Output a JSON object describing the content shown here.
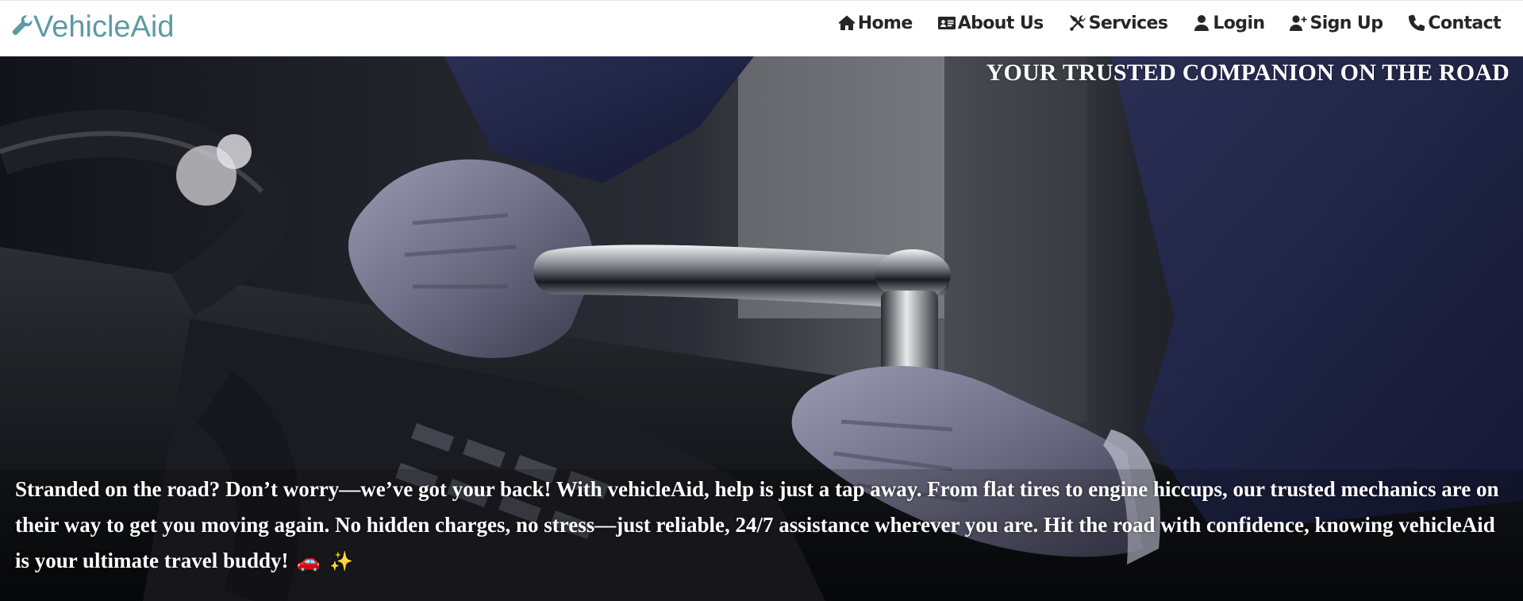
{
  "brand": {
    "name": "VehicleAid",
    "icon": "wrench-icon",
    "color": "#5e9aa3"
  },
  "nav": {
    "items": [
      {
        "label": "Home",
        "icon": "home-icon"
      },
      {
        "label": "About Us",
        "icon": "id-card-icon"
      },
      {
        "label": "Services",
        "icon": "tools-icon"
      },
      {
        "label": "Login",
        "icon": "user-icon"
      },
      {
        "label": "Sign Up",
        "icon": "user-plus-icon"
      },
      {
        "label": "Contact",
        "icon": "phone-icon"
      }
    ]
  },
  "hero": {
    "tagline": "YOUR TRUSTED COMPANION ON THE ROAD",
    "description": "Stranded on the road? Don’t worry—we’ve got your back! With vehicleAid, help is just a tap away. From flat tires to engine hiccups, our trusted mechanics are on their way to get you moving again. No hidden charges, no stress—just reliable, 24/7 assistance wherever you are. Hit the road with confidence, knowing vehicleAid is your ultimate travel buddy!",
    "emoji_car": "🚗",
    "emoji_sparkle": "✨",
    "background_image": "mechanic-wrench-engine-photo"
  }
}
